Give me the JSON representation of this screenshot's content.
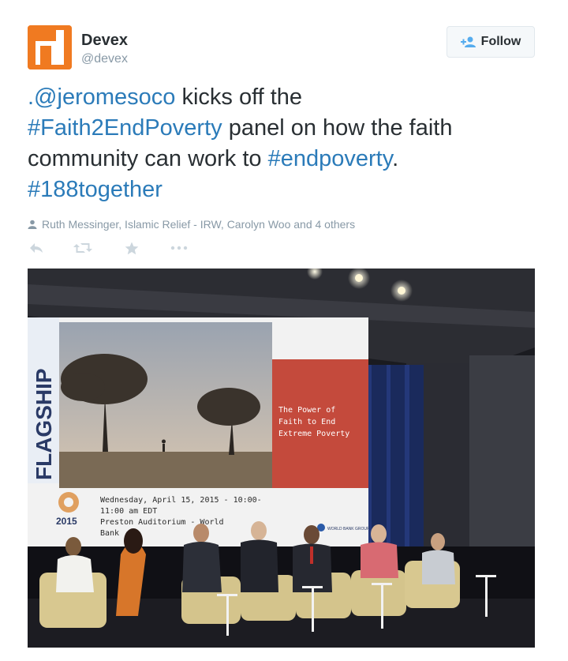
{
  "user": {
    "display_name": "Devex",
    "handle": "@devex",
    "avatar_letter": "d",
    "avatar_color": "#f07a21"
  },
  "follow_button": {
    "label": "Follow",
    "icon": "add-user-icon"
  },
  "tweet": {
    "mention": ".@jeromesoco",
    "text_1": " kicks off the",
    "hashtag_1": "#Faith2EndPoverty",
    "text_2": " panel on how the faith community can work to ",
    "hashtag_2": "#endpoverty",
    "text_3": ".",
    "hashtag_3": "#188together"
  },
  "social_proof": {
    "icon": "person-icon",
    "text": "Ruth Messinger, Islamic Relief - IRW, Carolyn Woo and 4 others"
  },
  "actions": [
    "reply-icon",
    "retweet-icon",
    "favorite-icon",
    "more-icon"
  ],
  "photo": {
    "slide_vertical_label": "FLAGSHIP",
    "slide_title_lines": [
      "The Power of",
      "Faith to End",
      "Extreme Poverty"
    ],
    "slide_info_lines": [
      "Wednesday, April 15, 2015  -  10:00-",
      "11:00 am EDT",
      "Preston Auditorium  -  World",
      "Bank"
    ],
    "year_badge": "2015",
    "brand_badge": "WORLD BANK GROUP",
    "colors": {
      "slide_red": "#c44a3c",
      "stage_blue": "#1a2a5c",
      "link_blue": "#2b7bb9"
    }
  }
}
